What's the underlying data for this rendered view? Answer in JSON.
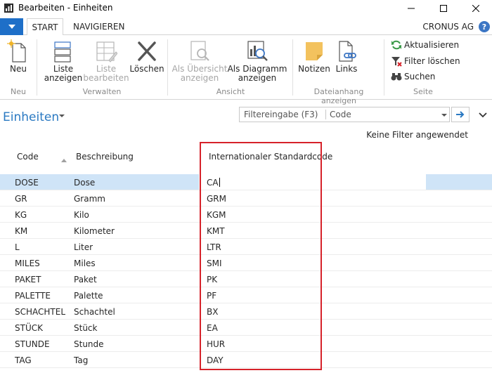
{
  "window": {
    "title": "Bearbeiten - Einheiten"
  },
  "tabs": {
    "start": "START",
    "navigate": "NAVIGIEREN"
  },
  "company": "CRONUS AG",
  "ribbon": {
    "new_label": "Neu",
    "group_new": "Neu",
    "list_show": "Liste\nanzeigen",
    "list_edit": "Liste\nbearbeiten",
    "delete": "Löschen",
    "group_manage": "Verwalten",
    "as_overview": "Als Übersicht\nanzeigen",
    "as_chart": "Als Diagramm\nanzeigen",
    "group_view": "Ansicht",
    "notes": "Notizen",
    "links": "Links",
    "group_attachments": "Dateianhang anzeigen",
    "refresh": "Aktualisieren",
    "clear_filter": "Filter löschen",
    "search": "Suchen",
    "group_page": "Seite"
  },
  "page": {
    "title": "Einheiten",
    "filter_label": "Filtereingabe (F3)",
    "filter_field": "Code",
    "no_filter": "Keine Filter angewendet"
  },
  "columns": {
    "code": "Code",
    "description": "Beschreibung",
    "std_code": "Internationaler Standardcode"
  },
  "rows": [
    {
      "code": "DOSE",
      "desc": "Dose",
      "std": "CA"
    },
    {
      "code": "GR",
      "desc": "Gramm",
      "std": "GRM"
    },
    {
      "code": "KG",
      "desc": "Kilo",
      "std": "KGM"
    },
    {
      "code": "KM",
      "desc": "Kilometer",
      "std": "KMT"
    },
    {
      "code": "L",
      "desc": "Liter",
      "std": "LTR"
    },
    {
      "code": "MILES",
      "desc": "Miles",
      "std": "SMI"
    },
    {
      "code": "PAKET",
      "desc": "Paket",
      "std": "PK"
    },
    {
      "code": "PALETTE",
      "desc": "Palette",
      "std": "PF"
    },
    {
      "code": "SCHACHTEL",
      "desc": "Schachtel",
      "std": "BX"
    },
    {
      "code": "STÜCK",
      "desc": "Stück",
      "std": "EA"
    },
    {
      "code": "STUNDE",
      "desc": "Stunde",
      "std": "HUR"
    },
    {
      "code": "TAG",
      "desc": "Tag",
      "std": "DAY"
    }
  ],
  "colors": {
    "accent": "#1e6fc8",
    "title": "#2a79c2",
    "selection": "#cfe4f7",
    "highlight": "#d6222a"
  }
}
